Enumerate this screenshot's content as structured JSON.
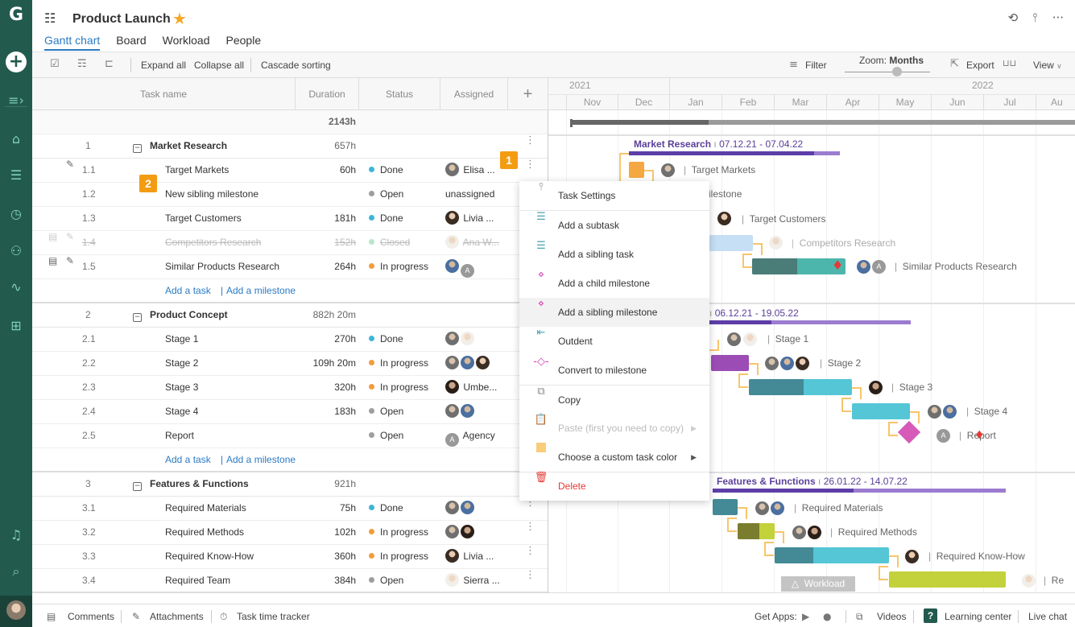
{
  "app": {
    "logo": "G",
    "project_title": "Product Launch"
  },
  "tabs": [
    "Gantt chart",
    "Board",
    "Workload",
    "People"
  ],
  "active_tab": "Gantt chart",
  "toolbar": {
    "expand_all": "Expand all",
    "collapse_all": "Collapse all",
    "cascade_sorting": "Cascade sorting",
    "filter": "Filter",
    "zoom_label": "Zoom:",
    "zoom_value": "Months",
    "export": "Export",
    "view": "View"
  },
  "columns": {
    "task_name": "Task name",
    "duration": "Duration",
    "status": "Status",
    "assigned": "Assigned",
    "add": "+"
  },
  "total_duration": "2143h",
  "groups": [
    {
      "num": "1",
      "name": "Market Research",
      "duration": "657h",
      "chart_label": "Market Research",
      "dates": "07.12.21 - 07.04.22",
      "tasks": [
        {
          "num": "1.1",
          "name": "Target Markets",
          "duration": "60h",
          "status": "Done",
          "assigned": "Elisa ...",
          "attach": true
        },
        {
          "num": "1.2",
          "name": "New sibling milestone",
          "duration": "",
          "status": "Open",
          "assigned": "unassigned"
        },
        {
          "num": "1.3",
          "name": "Target Customers",
          "duration": "181h",
          "status": "Done",
          "assigned": "Livia ..."
        },
        {
          "num": "1.4",
          "name": "Competitors Research",
          "duration": "152h",
          "status": "Closed",
          "assigned": "Ana W...",
          "closed": true
        },
        {
          "num": "1.5",
          "name": "Similar Products Research",
          "duration": "264h",
          "status": "In progress",
          "assigned": ""
        }
      ]
    },
    {
      "num": "2",
      "name": "Product Concept",
      "duration": "882h 20m",
      "chart_label": "Product Concept",
      "dates": "06.12.21 - 19.05.22",
      "tasks": [
        {
          "num": "2.1",
          "name": "Stage 1",
          "duration": "270h",
          "status": "Done",
          "assigned": ""
        },
        {
          "num": "2.2",
          "name": "Stage 2",
          "duration": "109h 20m",
          "status": "In progress",
          "assigned": ""
        },
        {
          "num": "2.3",
          "name": "Stage 3",
          "duration": "320h",
          "status": "In progress",
          "assigned": "Umbe..."
        },
        {
          "num": "2.4",
          "name": "Stage 4",
          "duration": "183h",
          "status": "Open",
          "assigned": ""
        },
        {
          "num": "2.5",
          "name": "Report",
          "duration": "",
          "status": "Open",
          "assigned": "Agency"
        }
      ]
    },
    {
      "num": "3",
      "name": "Features & Functions",
      "duration": "921h",
      "chart_label": "Features & Functions",
      "dates": "26.01.22 - 14.07.22",
      "tasks": [
        {
          "num": "3.1",
          "name": "Required Materials",
          "duration": "75h",
          "status": "Done",
          "assigned": ""
        },
        {
          "num": "3.2",
          "name": "Required Methods",
          "duration": "102h",
          "status": "In progress",
          "assigned": ""
        },
        {
          "num": "3.3",
          "name": "Required Know-How",
          "duration": "360h",
          "status": "In progress",
          "assigned": "Livia ..."
        },
        {
          "num": "3.4",
          "name": "Required Team",
          "duration": "384h",
          "status": "Open",
          "assigned": "Sierra ..."
        }
      ]
    }
  ],
  "add_links": {
    "task": "Add a task",
    "milestone": "Add a milestone"
  },
  "status_colors": {
    "Done": "#3db5d8",
    "Open": "#9e9e9e",
    "In progress": "#f39c3b",
    "Closed": "#b9e6c9"
  },
  "badges": [
    "1",
    "2"
  ],
  "timeline": {
    "years": [
      "2021",
      "2022"
    ],
    "months": [
      "Nov",
      "Dec",
      "Jan",
      "Feb",
      "Mar",
      "Apr",
      "May",
      "Jun",
      "Jul",
      "Au"
    ]
  },
  "context_menu": [
    {
      "label": "Task Settings",
      "icon": "sliders-icon"
    },
    {
      "label": "Add a subtask",
      "icon": "subtask-icon"
    },
    {
      "label": "Add a sibling task",
      "icon": "sibling-task-icon"
    },
    {
      "label": "Add a child milestone",
      "icon": "child-milestone-icon"
    },
    {
      "label": "Add a sibling milestone",
      "icon": "sibling-milestone-icon",
      "highlighted": true
    },
    {
      "label": "Outdent",
      "icon": "outdent-icon"
    },
    {
      "label": "Convert to milestone",
      "icon": "milestone-icon"
    },
    {
      "label": "Copy",
      "icon": "copy-icon"
    },
    {
      "label": "Paste (first you need to copy)",
      "icon": "paste-icon",
      "disabled": true
    },
    {
      "label": "Choose a custom task color",
      "icon": "color-swatch-icon"
    },
    {
      "label": "Delete",
      "icon": "trash-icon"
    }
  ],
  "gantt_labels": {
    "target_markets": "Target Markets",
    "new_milestone": "ilestone",
    "target_customers": "Target Customers",
    "competitors": "Competitors Research",
    "similar": "Similar Products Research",
    "stage1": "Stage 1",
    "stage2": "Stage 2",
    "stage3": "Stage 3",
    "stage4": "Stage 4",
    "report": "Report",
    "materials": "Required Materials",
    "methods": "Required Methods",
    "knowhow": "Required Know-How",
    "team": "Re"
  },
  "workload_button": "Workload",
  "footer": {
    "comments": "Comments",
    "attachments": "Attachments",
    "time_tracker": "Task time tracker",
    "get_apps": "Get Apps:",
    "videos": "Videos",
    "learning_center": "Learning center",
    "live_chat": "Live chat"
  }
}
